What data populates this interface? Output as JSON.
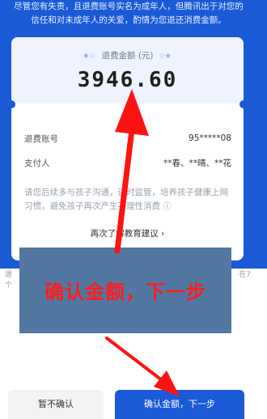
{
  "intro_text": "尽管您有失责，且退费账号实名为成年人，但腾讯出于对您的信任和对未成年人的关爱，酌情为您退还消费金额。",
  "card": {
    "title": "退费金额 (元)",
    "amount": "3946.60",
    "rows": [
      {
        "label": "退费账号",
        "value": "95*****08"
      },
      {
        "label": "支付人",
        "value": "**春、**晴、**花"
      }
    ],
    "tip": "请您后续多与孩子沟通，适时监管，培养孩子健康上网习惯，避免孩子再次产生不理性消费 ⓘ",
    "education_link": "再次了解教育建议 ›"
  },
  "side": {
    "left": "退",
    "left2": "个",
    "right": "在7"
  },
  "overlay_caption": "确认金额，下一步",
  "buttons": {
    "cancel": "暂不确认",
    "confirm": "确认金额，下一步"
  },
  "colors": {
    "brand_blue": "#1a5ad7",
    "annotation_red": "#ff1e1e",
    "overlay_blue": "#5277a1"
  }
}
